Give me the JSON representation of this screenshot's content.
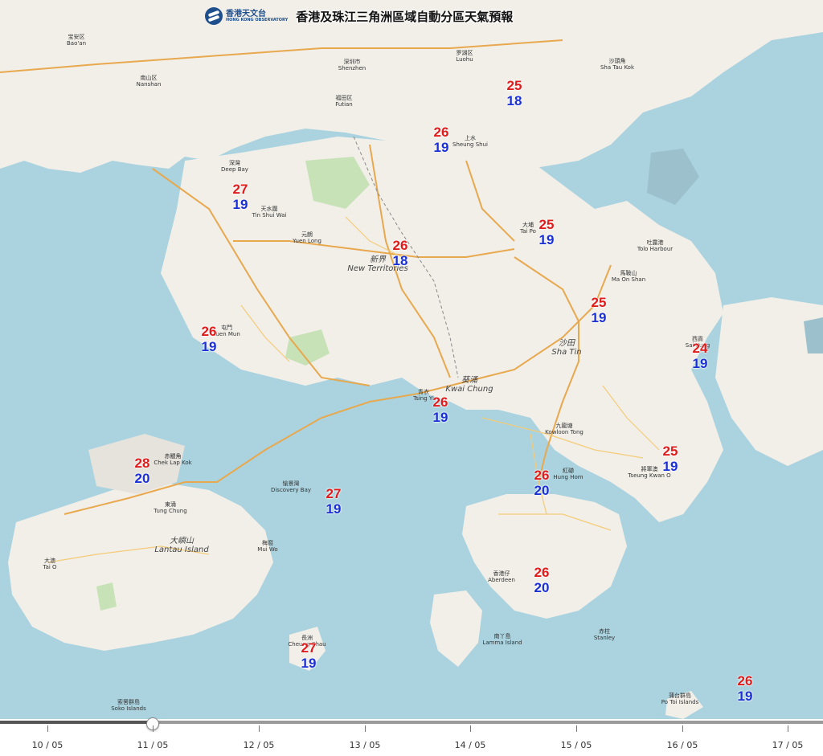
{
  "header": {
    "logo_cn": "香港天文台",
    "logo_en": "HONG KONG OBSERVATORY",
    "title": "香港及珠江三角洲區域自動分區天氣預報"
  },
  "forecasts": [
    {
      "max": "25",
      "min": "18"
    },
    {
      "max": "26",
      "min": "19"
    },
    {
      "max": "27",
      "min": "19"
    },
    {
      "max": "26",
      "min": "18"
    },
    {
      "max": "25",
      "min": "19"
    },
    {
      "max": "26",
      "min": "19"
    },
    {
      "max": "25",
      "min": "19"
    },
    {
      "max": "24",
      "min": "19"
    },
    {
      "max": "26",
      "min": "19"
    },
    {
      "max": "28",
      "min": "20"
    },
    {
      "max": "27",
      "min": "19"
    },
    {
      "max": "26",
      "min": "20"
    },
    {
      "max": "25",
      "min": "19"
    },
    {
      "max": "26",
      "min": "20"
    },
    {
      "max": "27",
      "min": "19"
    },
    {
      "max": "26",
      "min": "19"
    }
  ],
  "places": [
    {
      "cn": "宝安区",
      "en": "Bao'an"
    },
    {
      "cn": "南山区",
      "en": "Nanshan"
    },
    {
      "cn": "福田区",
      "en": "Futian"
    },
    {
      "cn": "深圳市",
      "en": "Shenzhen"
    },
    {
      "cn": "罗湖区",
      "en": "Luohu"
    },
    {
      "cn": "沙頭角",
      "en": "Sha Tau Kok"
    },
    {
      "cn": "上水",
      "en": "Sheung Shui"
    },
    {
      "cn": "天水圍",
      "en": "Tin Shui Wai"
    },
    {
      "cn": "元朗",
      "en": "Yuen Long"
    },
    {
      "cn": "新界",
      "en": "New Territories"
    },
    {
      "cn": "大埔",
      "en": "Tai Po"
    },
    {
      "cn": "屯門",
      "en": "Tuen Mun"
    },
    {
      "cn": "沙田",
      "en": "Sha Tin"
    },
    {
      "cn": "馬鞍山",
      "en": "Ma On Shan"
    },
    {
      "cn": "葵涌",
      "en": "Kwai Chung"
    },
    {
      "cn": "青衣",
      "en": "Tsing Yi"
    },
    {
      "cn": "赤鱲角",
      "en": "Chek Lap Kok"
    },
    {
      "cn": "東涌",
      "en": "Tung Chung"
    },
    {
      "cn": "大嶼山",
      "en": "Lantau Island"
    },
    {
      "cn": "愉景灣",
      "en": "Discovery Bay"
    },
    {
      "cn": "梅窩",
      "en": "Mui Wo"
    },
    {
      "cn": "大澳",
      "en": "Tai O"
    },
    {
      "cn": "長洲",
      "en": "Cheung Chau"
    },
    {
      "cn": "南丫島",
      "en": "Lamma Island"
    },
    {
      "cn": "香港仔",
      "en": "Aberdeen"
    },
    {
      "cn": "赤柱",
      "en": "Stanley"
    },
    {
      "cn": "將軍澳",
      "en": "Tseung Kwan O"
    },
    {
      "cn": "西貢",
      "en": "Sai Kung"
    },
    {
      "cn": "蒲台群島",
      "en": "Po Toi Islands"
    },
    {
      "cn": "九龍塘",
      "en": "Kowloon Tong"
    },
    {
      "cn": "紅磡",
      "en": "Hung Hom"
    },
    {
      "cn": "索罟群島",
      "en": "Soko Islands"
    },
    {
      "cn": "吐露港",
      "en": "Tolo Harbour"
    },
    {
      "cn": "深灣",
      "en": "Deep Bay"
    }
  ],
  "timeline": {
    "dates": [
      "10 / 05",
      "11 / 05",
      "12 / 05",
      "13 / 05",
      "14 / 05",
      "15 / 05",
      "16 / 05",
      "17 / 05"
    ],
    "selected_index": 1
  },
  "colors": {
    "sea": "#aad3df",
    "land": "#f2efe9",
    "green": "#c8e2b8",
    "max_temp": "#e11b1b",
    "min_temp": "#1a2fd6"
  }
}
